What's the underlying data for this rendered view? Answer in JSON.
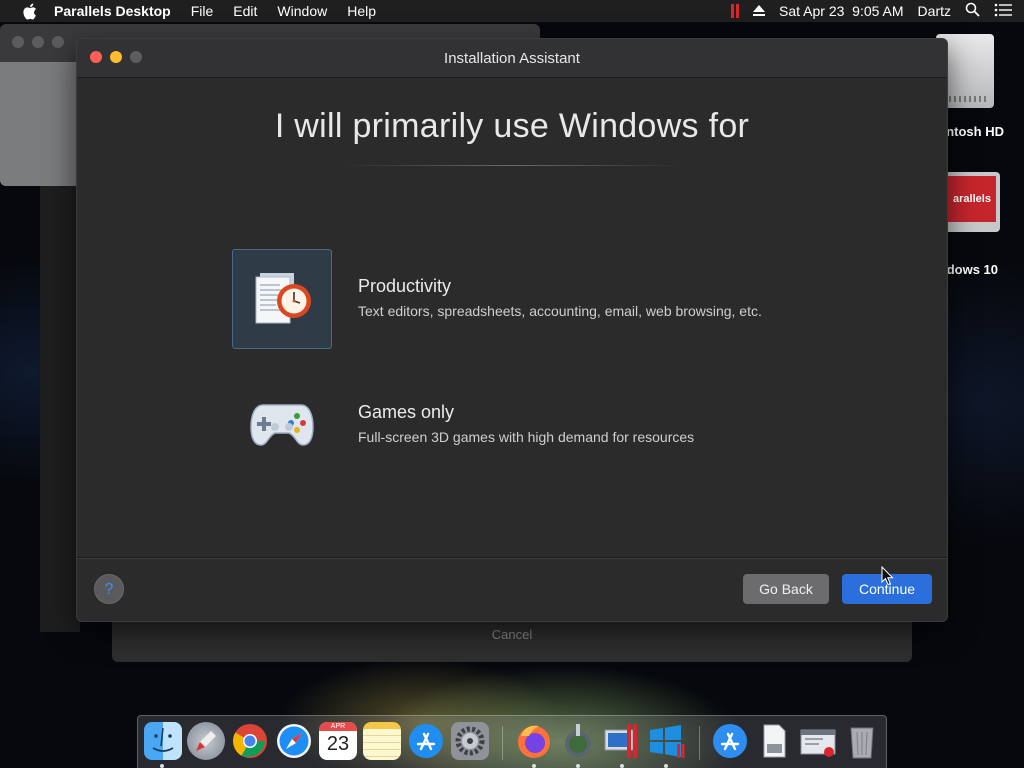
{
  "menubar": {
    "app_name": "Parallels Desktop",
    "menus": [
      "File",
      "Edit",
      "Window",
      "Help"
    ],
    "datetime": "Sat Apr 23  9:05 AM",
    "user": "Dartz"
  },
  "desktop_icons": {
    "hd_label": "ntosh HD",
    "parallels_label": "dows 10",
    "parallels_logo": "arallels"
  },
  "background_sheet": {
    "cancel_label": "Cancel"
  },
  "window": {
    "title": "Installation Assistant",
    "heading": "I will primarily use Windows for",
    "options": [
      {
        "title": "Productivity",
        "description": "Text editors, spreadsheets, accounting, email, web browsing, etc.",
        "icon": "productivity-icon",
        "selected": true
      },
      {
        "title": "Games only",
        "description": "Full-screen 3D games with high demand for resources",
        "icon": "gamepad-icon",
        "selected": false
      }
    ],
    "help_label": "?",
    "go_back_label": "Go Back",
    "continue_label": "Continue"
  },
  "dock": {
    "calendar_month": "APR",
    "calendar_day": "23",
    "apps": [
      "finder",
      "launchpad",
      "chrome",
      "safari",
      "calendar",
      "notes",
      "app-store",
      "system-preferences",
      "firefox",
      "unknown-app",
      "parallels-control-center",
      "windows-10",
      "app-store-downloads",
      "documents",
      "parallels-wizard",
      "trash"
    ]
  },
  "colors": {
    "accent": "#2a6fdb",
    "window_bg": "#2b2b2c",
    "selection_bg": "#2f3b47",
    "close": "#fe5f57",
    "minimize": "#febc2e"
  }
}
